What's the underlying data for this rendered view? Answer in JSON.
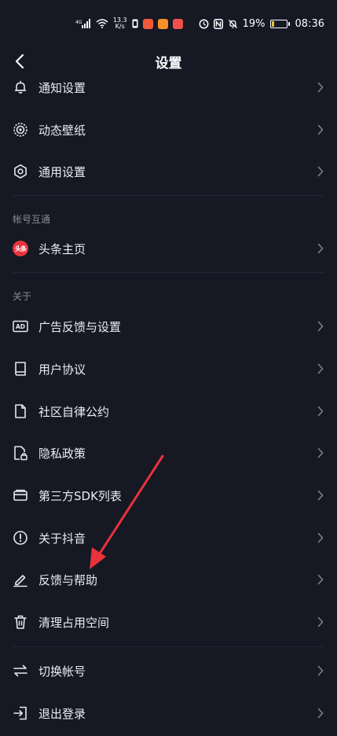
{
  "status_bar": {
    "net_speed_value": "13.3",
    "net_speed_unit": "K/s",
    "battery_percent": "19%",
    "time": "08:36",
    "battery_level": 0.19,
    "colors": {
      "battery_fill": "#f2c230",
      "app_badge_1": "#f05a3a",
      "app_badge_2": "#f5902c",
      "app_badge_3": "#f0504a"
    }
  },
  "header": {
    "title": "设置"
  },
  "menu": {
    "notify": "通知设置",
    "wallpaper": "动态壁纸",
    "general": "通用设置",
    "account_section": "帐号互通",
    "toutiao_badge": "头条",
    "toutiao": "头条主页",
    "about_section": "关于",
    "ad_badge": "AD",
    "ad": "广告反馈与设置",
    "agreement": "用户协议",
    "community": "社区自律公约",
    "privacy": "隐私政策",
    "sdk": "第三方SDK列表",
    "about_douyin": "关于抖音",
    "feedback": "反馈与帮助",
    "clear": "清理占用空间",
    "switch_account": "切换帐号",
    "logout": "退出登录"
  },
  "icons": {
    "notify": "bell-icon",
    "wallpaper": "wallpaper-icon",
    "general": "gear-icon",
    "toutiao": "toutiao-logo",
    "ad": "ad-icon",
    "agreement": "book-icon",
    "community": "document-icon",
    "privacy": "lock-document-icon",
    "sdk": "wallet-icon",
    "about_douyin": "info-icon",
    "feedback": "pen-icon",
    "clear": "trash-icon",
    "switch_account": "swap-icon",
    "logout": "logout-icon"
  },
  "annotation_color": "#e8323c"
}
